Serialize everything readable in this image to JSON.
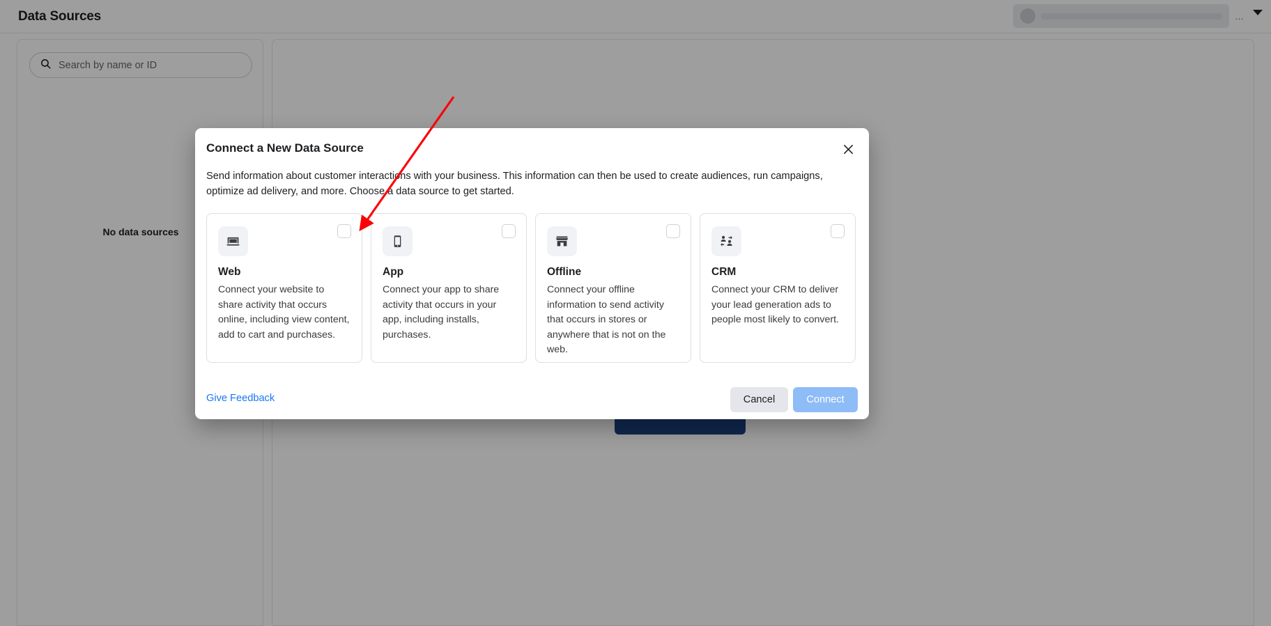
{
  "page": {
    "title": "Data Sources",
    "search": {
      "placeholder": "Search by name or ID",
      "icon": "search-icon"
    },
    "empty_state": "No data sources"
  },
  "modal": {
    "title": "Connect a New Data Source",
    "close_icon": "close-icon",
    "description": "Send information about customer interactions with your business. This information can then be used to create audiences, run campaigns, optimize ad delivery, and more. Choose a data source to get started.",
    "cards": [
      {
        "id": "web",
        "icon": "laptop-icon",
        "title": "Web",
        "text": "Connect your website to share activity that occurs online, including view content, add to cart and purchases.",
        "checked": false
      },
      {
        "id": "app",
        "icon": "mobile-phone-icon",
        "title": "App",
        "text": "Connect your app to share activity that occurs in your app, including installs, purchases.",
        "checked": false
      },
      {
        "id": "offline",
        "icon": "storefront-icon",
        "title": "Offline",
        "text": "Connect your offline information to send activity that occurs in stores or anywhere that is not on the web.",
        "checked": false
      },
      {
        "id": "crm",
        "icon": "people-sync-icon",
        "title": "CRM",
        "text": "Connect your CRM to deliver your lead generation ads to people most likely to convert.",
        "checked": false
      }
    ],
    "footer": {
      "feedback_label": "Give Feedback",
      "cancel_label": "Cancel",
      "connect_label": "Connect"
    }
  },
  "colors": {
    "link": "#1877f2",
    "primary": "#1b3f7f",
    "connect_disabled": "#8ebcf7",
    "annotation": "#fb0007"
  }
}
